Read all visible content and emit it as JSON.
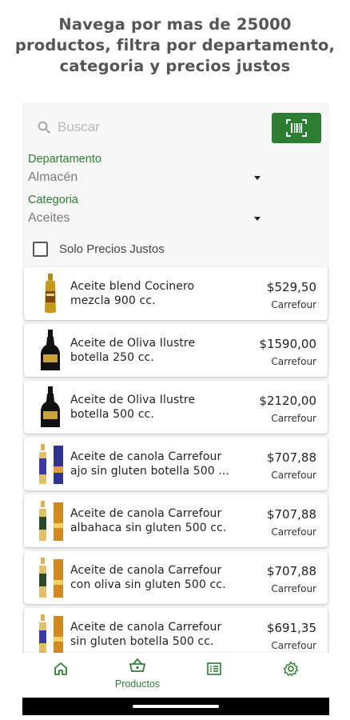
{
  "headline": {
    "line1": "Navega por mas de 25000",
    "line2": "productos, filtra por departamento,",
    "line3": "categoria y precios justos"
  },
  "search": {
    "placeholder": "Buscar",
    "icon": "search-icon"
  },
  "scan_button": {
    "icon": "barcode-scan-icon"
  },
  "filters": {
    "department": {
      "label": "Departamento",
      "value": "Almacén"
    },
    "category": {
      "label": "Categoria",
      "value": "Aceites"
    },
    "fair_prices": {
      "label": "Solo Precios Justos",
      "checked": false
    }
  },
  "products": [
    {
      "line1": "Aceite blend Cocinero",
      "line2": "mezcla 900 cc.",
      "price": "$529,50",
      "store": "Carrefour",
      "thumb": "amber-bottle"
    },
    {
      "line1": "Aceite de Oliva Ilustre",
      "line2": "botella 250 cc.",
      "price": "$1590,00",
      "store": "Carrefour",
      "thumb": "black-bottle"
    },
    {
      "line1": "Aceite de Oliva Ilustre",
      "line2": "botella 500 cc.",
      "price": "$2120,00",
      "store": "Carrefour",
      "thumb": "black-bottle"
    },
    {
      "line1": "Aceite de canola Carrefour",
      "line2": "ajo sin gluten botella 500 ...",
      "price": "$707,88",
      "store": "Carrefour",
      "thumb": "blue-label-bottle"
    },
    {
      "line1": "Aceite de canola Carrefour",
      "line2": "albahaca sin gluten 500 cc.",
      "price": "$707,88",
      "store": "Carrefour",
      "thumb": "orange-label-bottle"
    },
    {
      "line1": "Aceite de canola Carrefour",
      "line2": "con oliva sin gluten 500 cc.",
      "price": "$707,88",
      "store": "Carrefour",
      "thumb": "orange-label-bottle"
    },
    {
      "line1": "Aceite de canola Carrefour",
      "line2": "sin gluten botella 500 cc.",
      "price": "$691,35",
      "store": "Carrefour",
      "thumb": "orange-label-bottle"
    }
  ],
  "bottom_nav": [
    {
      "icon": "home-icon",
      "label": ""
    },
    {
      "icon": "basket-icon",
      "label": "Productos",
      "active": true
    },
    {
      "icon": "list-icon",
      "label": ""
    },
    {
      "icon": "settings-icon",
      "label": ""
    }
  ],
  "colors": {
    "accent": "#2e7d32",
    "headline": "#555555",
    "background": "#f7f7f7"
  }
}
